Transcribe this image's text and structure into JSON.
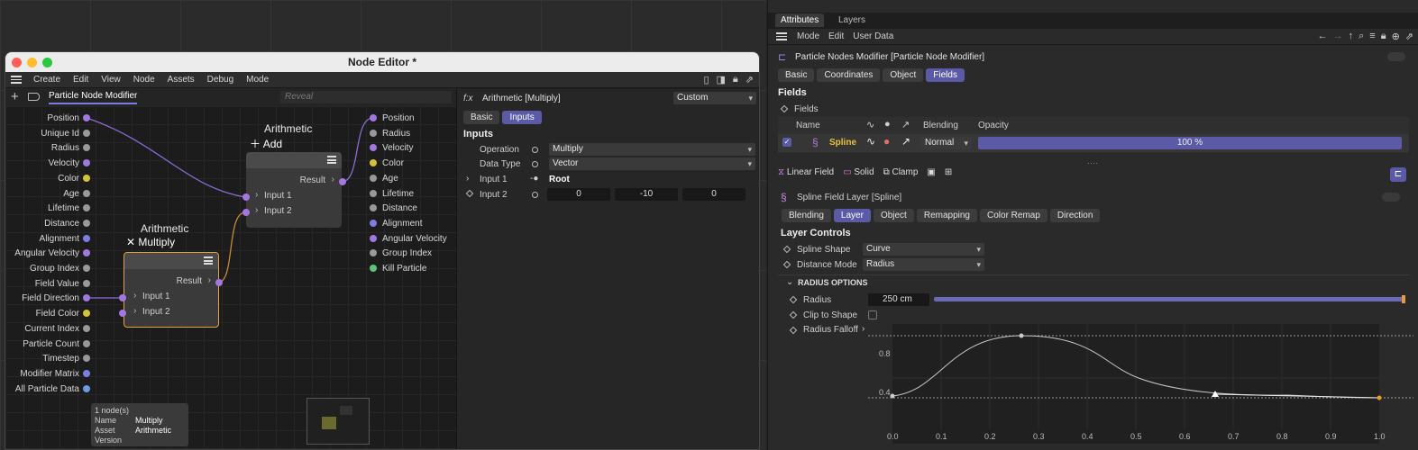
{
  "attributes": {
    "tabs": [
      "Attributes",
      "Layers"
    ],
    "menu": [
      "Mode",
      "Edit",
      "User Data"
    ],
    "object_title": "Particle Nodes Modifier [Particle Node Modifier]",
    "obj_tabs": [
      "Basic",
      "Coordinates",
      "Object",
      "Fields"
    ],
    "section": "Fields",
    "fields_label": "Fields",
    "table_headers": {
      "name": "Name",
      "blending": "Blending",
      "opacity": "Opacity"
    },
    "spline_row": {
      "name": "Spline",
      "blending": "Normal",
      "opacity": "100 %",
      "opacity_value": 1.0
    },
    "layer_tools": [
      "Linear Field",
      "Solid",
      "Clamp"
    ],
    "layer_title": "Spline Field Layer [Spline]",
    "layer_tabs": [
      "Blending",
      "Layer",
      "Object",
      "Remapping",
      "Color Remap",
      "Direction"
    ],
    "layer_controls": "Layer Controls",
    "spline_shape": {
      "label": "Spline Shape",
      "value": "Curve"
    },
    "distance_mode": {
      "label": "Distance Mode",
      "value": "Radius"
    },
    "radius_options": "RADIUS OPTIONS",
    "radius": {
      "label": "Radius",
      "value": "250 cm",
      "fraction": 1.0
    },
    "clip": {
      "label": "Clip to Shape"
    },
    "falloff": {
      "label": "Radius Falloff"
    },
    "curve_axis": {
      "x": [
        "0.0",
        "0.1",
        "0.2",
        "0.3",
        "0.4",
        "0.5",
        "0.6",
        "0.7",
        "0.8",
        "0.9",
        "1.0"
      ],
      "y": [
        "0.8",
        "0.4"
      ]
    }
  },
  "node_editor": {
    "title": "Node Editor *",
    "menu": [
      "Create",
      "Edit",
      "View",
      "Node",
      "Assets",
      "Debug",
      "Mode"
    ],
    "tab": "Particle Node Modifier",
    "reveal_placeholder": "Reveal",
    "left_ports": [
      {
        "label": "Position",
        "color": "#a277e0"
      },
      {
        "label": "Unique Id",
        "color": "#999999"
      },
      {
        "label": "Radius",
        "color": "#999999"
      },
      {
        "label": "Velocity",
        "color": "#a277e0"
      },
      {
        "label": "Color",
        "color": "#d6c13a"
      },
      {
        "label": "Age",
        "color": "#999999"
      },
      {
        "label": "Lifetime",
        "color": "#999999"
      },
      {
        "label": "Distance",
        "color": "#999999"
      },
      {
        "label": "Alignment",
        "color": "#7d7ee0"
      },
      {
        "label": "Angular Velocity",
        "color": "#a277e0"
      },
      {
        "label": "Group Index",
        "color": "#999999"
      },
      {
        "label": "Field Value",
        "color": "#999999"
      },
      {
        "label": "Field Direction",
        "color": "#a277e0"
      },
      {
        "label": "Field Color",
        "color": "#d6c13a"
      },
      {
        "label": "Current Index",
        "color": "#999999"
      },
      {
        "label": "Particle Count",
        "color": "#999999"
      },
      {
        "label": "Timestep",
        "color": "#999999"
      },
      {
        "label": "Modifier Matrix",
        "color": "#7d7ee0"
      },
      {
        "label": "All Particle Data",
        "color": "#6b9be0"
      }
    ],
    "right_ports": [
      {
        "label": "Position",
        "color": "#a277e0"
      },
      {
        "label": "Radius",
        "color": "#999999"
      },
      {
        "label": "Velocity",
        "color": "#a277e0"
      },
      {
        "label": "Color",
        "color": "#d6c13a"
      },
      {
        "label": "Age",
        "color": "#999999"
      },
      {
        "label": "Lifetime",
        "color": "#999999"
      },
      {
        "label": "Distance",
        "color": "#999999"
      },
      {
        "label": "Alignment",
        "color": "#7d7ee0"
      },
      {
        "label": "Angular Velocity",
        "color": "#a277e0"
      },
      {
        "label": "Group Index",
        "color": "#999999"
      },
      {
        "label": "Kill Particle",
        "color": "#5ec27a"
      }
    ],
    "node_add": {
      "title": "Arithmetic",
      "op": "Add",
      "result": "Result",
      "in1": "Input 1",
      "in2": "Input 2"
    },
    "node_mul": {
      "title": "Arithmetic",
      "op": "Multiply",
      "result": "Result",
      "in1": "Input 1",
      "in2": "Input 2"
    },
    "info": {
      "count": "1 node(s)",
      "name_label": "Name",
      "name": "Multiply",
      "asset_label": "Asset",
      "asset": "Arithmetic",
      "version_label": "Version"
    },
    "inspector": {
      "title": "Arithmetic [Multiply]",
      "preset": "Custom",
      "tabs": [
        "Basic",
        "Inputs"
      ],
      "section": "Inputs",
      "operation": {
        "label": "Operation",
        "value": "Multiply"
      },
      "datatype": {
        "label": "Data Type",
        "value": "Vector"
      },
      "input1": {
        "label": "Input 1",
        "value": "Root"
      },
      "input2": {
        "label": "Input 2",
        "values": [
          "0",
          "-10",
          "0"
        ]
      }
    }
  }
}
